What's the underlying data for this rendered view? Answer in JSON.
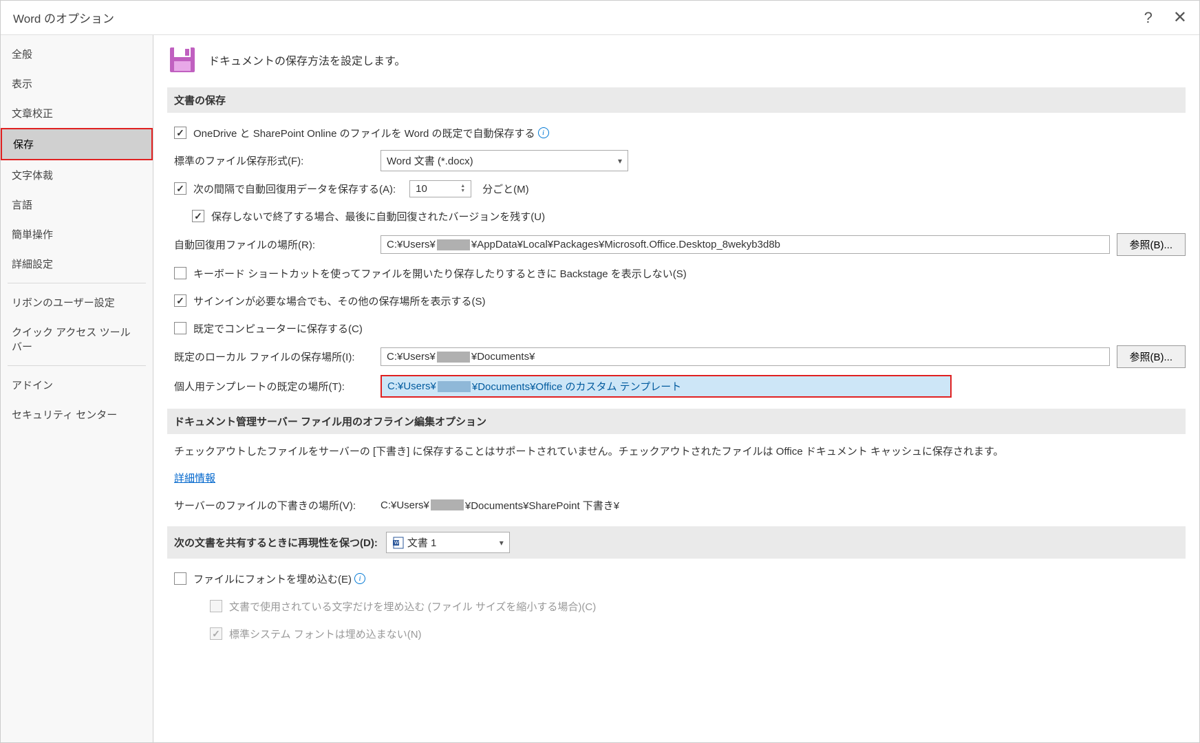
{
  "titlebar": {
    "title": "Word のオプション"
  },
  "sidebar": {
    "items": [
      {
        "label": "全般"
      },
      {
        "label": "表示"
      },
      {
        "label": "文章校正"
      },
      {
        "label": "保存",
        "selected": true
      },
      {
        "label": "文字体裁"
      },
      {
        "label": "言語"
      },
      {
        "label": "簡単操作"
      },
      {
        "label": "詳細設定"
      }
    ],
    "items2": [
      {
        "label": "リボンのユーザー設定"
      },
      {
        "label": "クイック アクセス ツール バー"
      }
    ],
    "items3": [
      {
        "label": "アドイン"
      },
      {
        "label": "セキュリティ センター"
      }
    ]
  },
  "header": {
    "text": "ドキュメントの保存方法を設定します。"
  },
  "section1": {
    "title": "文書の保存",
    "onedrive_autosave": "OneDrive と SharePoint Online のファイルを Word の既定で自動保存する",
    "file_format_label": "標準のファイル保存形式(F):",
    "file_format_value": "Word 文書 (*.docx)",
    "autorecover_label_pre": "次の間隔で自動回復用データを保存する(A):",
    "autorecover_value": "10",
    "autorecover_label_post": "分ごと(M)",
    "keep_last_autosave": "保存しないで終了する場合、最後に自動回復されたバージョンを残す(U)",
    "autorecover_location_label": "自動回復用ファイルの場所(R):",
    "autorecover_location_pre": "C:¥Users¥",
    "autorecover_location_post": "¥AppData¥Local¥Packages¥Microsoft.Office.Desktop_8wekyb3d8b",
    "browse1": "参照(B)...",
    "no_backstage": "キーボード ショートカットを使ってファイルを開いたり保存したりするときに Backstage を表示しない(S)",
    "show_additional": "サインインが必要な場合でも、その他の保存場所を表示する(S)",
    "save_to_computer": "既定でコンピューターに保存する(C)",
    "default_local_label": "既定のローカル ファイルの保存場所(I):",
    "default_local_pre": "C:¥Users¥",
    "default_local_post": "¥Documents¥",
    "browse2": "参照(B)...",
    "personal_templates_label": "個人用テンプレートの既定の場所(T):",
    "personal_templates_pre": "C:¥Users¥",
    "personal_templates_post": "¥Documents¥Office のカスタム テンプレート"
  },
  "section2": {
    "title": "ドキュメント管理サーバー ファイル用のオフライン編集オプション",
    "note": "チェックアウトしたファイルをサーバーの [下書き] に保存することはサポートされていません。チェックアウトされたファイルは Office ドキュメント キャッシュに保存されます。",
    "more_info": "詳細情報",
    "server_drafts_label": "サーバーのファイルの下書きの場所(V):",
    "server_drafts_pre": "C:¥Users¥",
    "server_drafts_post": "¥Documents¥SharePoint 下書き¥"
  },
  "section3": {
    "title": "次の文書を共有するときに再現性を保つ(D):",
    "doc_name": "文書 1",
    "embed_fonts": "ファイルにフォントを埋め込む(E)",
    "embed_only_used": "文書で使用されている文字だけを埋め込む (ファイル サイズを縮小する場合)(C)",
    "no_embed_system": "標準システム フォントは埋め込まない(N)"
  }
}
